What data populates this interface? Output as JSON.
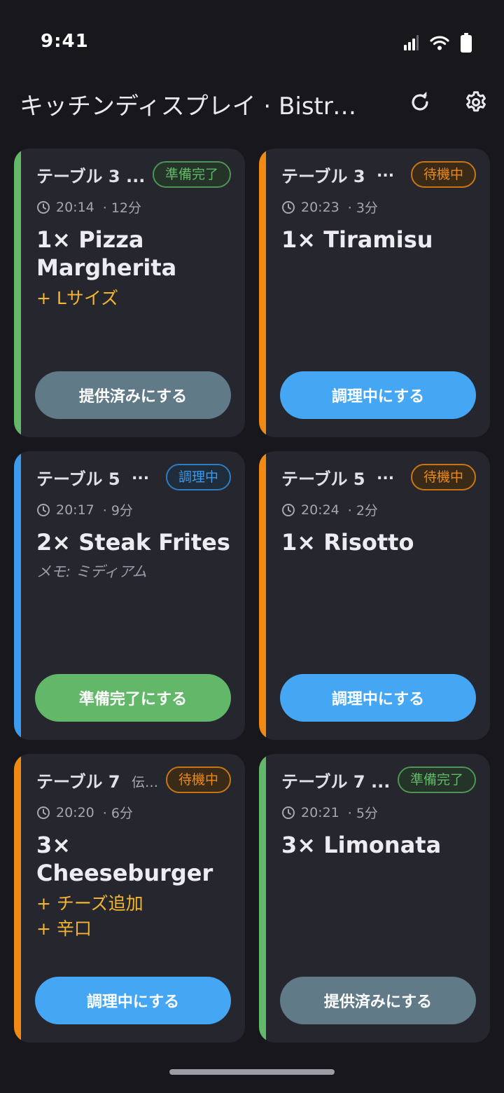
{
  "status_bar": {
    "time": "9:41"
  },
  "app_bar": {
    "title": "キッチンディスプレイ · Bistro ..."
  },
  "colors": {
    "ready": "#62b768",
    "waiting": "#f08a12",
    "cooking": "#3c9bec",
    "btn_served": "#617a88",
    "btn_cooking": "#45a6f3",
    "btn_ready": "#62b768",
    "modifier": "#f2b531"
  },
  "orders": [
    {
      "table": "テーブル 3 ...",
      "sub": "",
      "status": "準備完了",
      "status_kind": "ready",
      "time": "20:14",
      "elapsed": "· 12分",
      "item": "1× Pizza Margherita",
      "modifiers": [
        "+ Lサイズ"
      ],
      "note": "",
      "action": "提供済みにする",
      "action_kind": "btn_served"
    },
    {
      "table": "テーブル 3",
      "sub": "...",
      "status": "待機中",
      "status_kind": "waiting",
      "time": "20:23",
      "elapsed": "· 3分",
      "item": "1× Tiramisu",
      "modifiers": [],
      "note": "",
      "action": "調理中にする",
      "action_kind": "btn_cooking"
    },
    {
      "table": "テーブル 5",
      "sub": "...",
      "status": "調理中",
      "status_kind": "cooking",
      "time": "20:17",
      "elapsed": "· 9分",
      "item": "2× Steak Frites",
      "modifiers": [],
      "note": "メモ: ミディアム",
      "action": "準備完了にする",
      "action_kind": "btn_ready"
    },
    {
      "table": "テーブル 5",
      "sub": "...",
      "status": "待機中",
      "status_kind": "waiting",
      "time": "20:24",
      "elapsed": "· 2分",
      "item": "1× Risotto",
      "modifiers": [],
      "note": "",
      "action": "調理中にする",
      "action_kind": "btn_cooking"
    },
    {
      "table": "テーブル 7",
      "sub": "伝…",
      "status": "待機中",
      "status_kind": "waiting",
      "time": "20:20",
      "elapsed": "· 6分",
      "item": "3× Cheeseburger",
      "modifiers": [
        "+ チーズ追加",
        "+ 辛口"
      ],
      "note": "",
      "action": "調理中にする",
      "action_kind": "btn_cooking"
    },
    {
      "table": "テーブル 7 ...",
      "sub": "",
      "status": "準備完了",
      "status_kind": "ready",
      "time": "20:21",
      "elapsed": "· 5分",
      "item": "3× Limonata",
      "modifiers": [],
      "note": "",
      "action": "提供済みにする",
      "action_kind": "btn_served"
    }
  ]
}
